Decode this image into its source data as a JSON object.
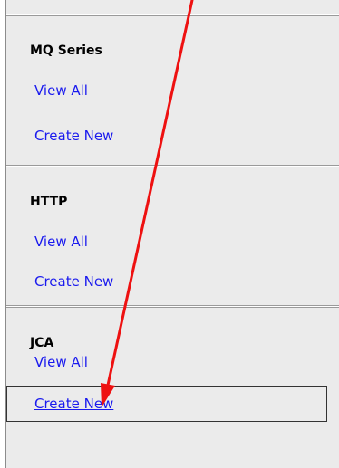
{
  "nav_sections": [
    {
      "heading": "MQ Series",
      "links": [
        "View All",
        "Create New"
      ]
    },
    {
      "heading": "HTTP",
      "links": [
        "View All",
        "Create New"
      ]
    },
    {
      "heading": "JCA",
      "links": [
        "View All",
        "Create New"
      ]
    }
  ],
  "colors": {
    "panel_bg": "#ebebeb",
    "link": "#1a1aee",
    "annotation_arrow": "#ee1111"
  },
  "annotation": {
    "icon": "red-arrow-icon"
  }
}
